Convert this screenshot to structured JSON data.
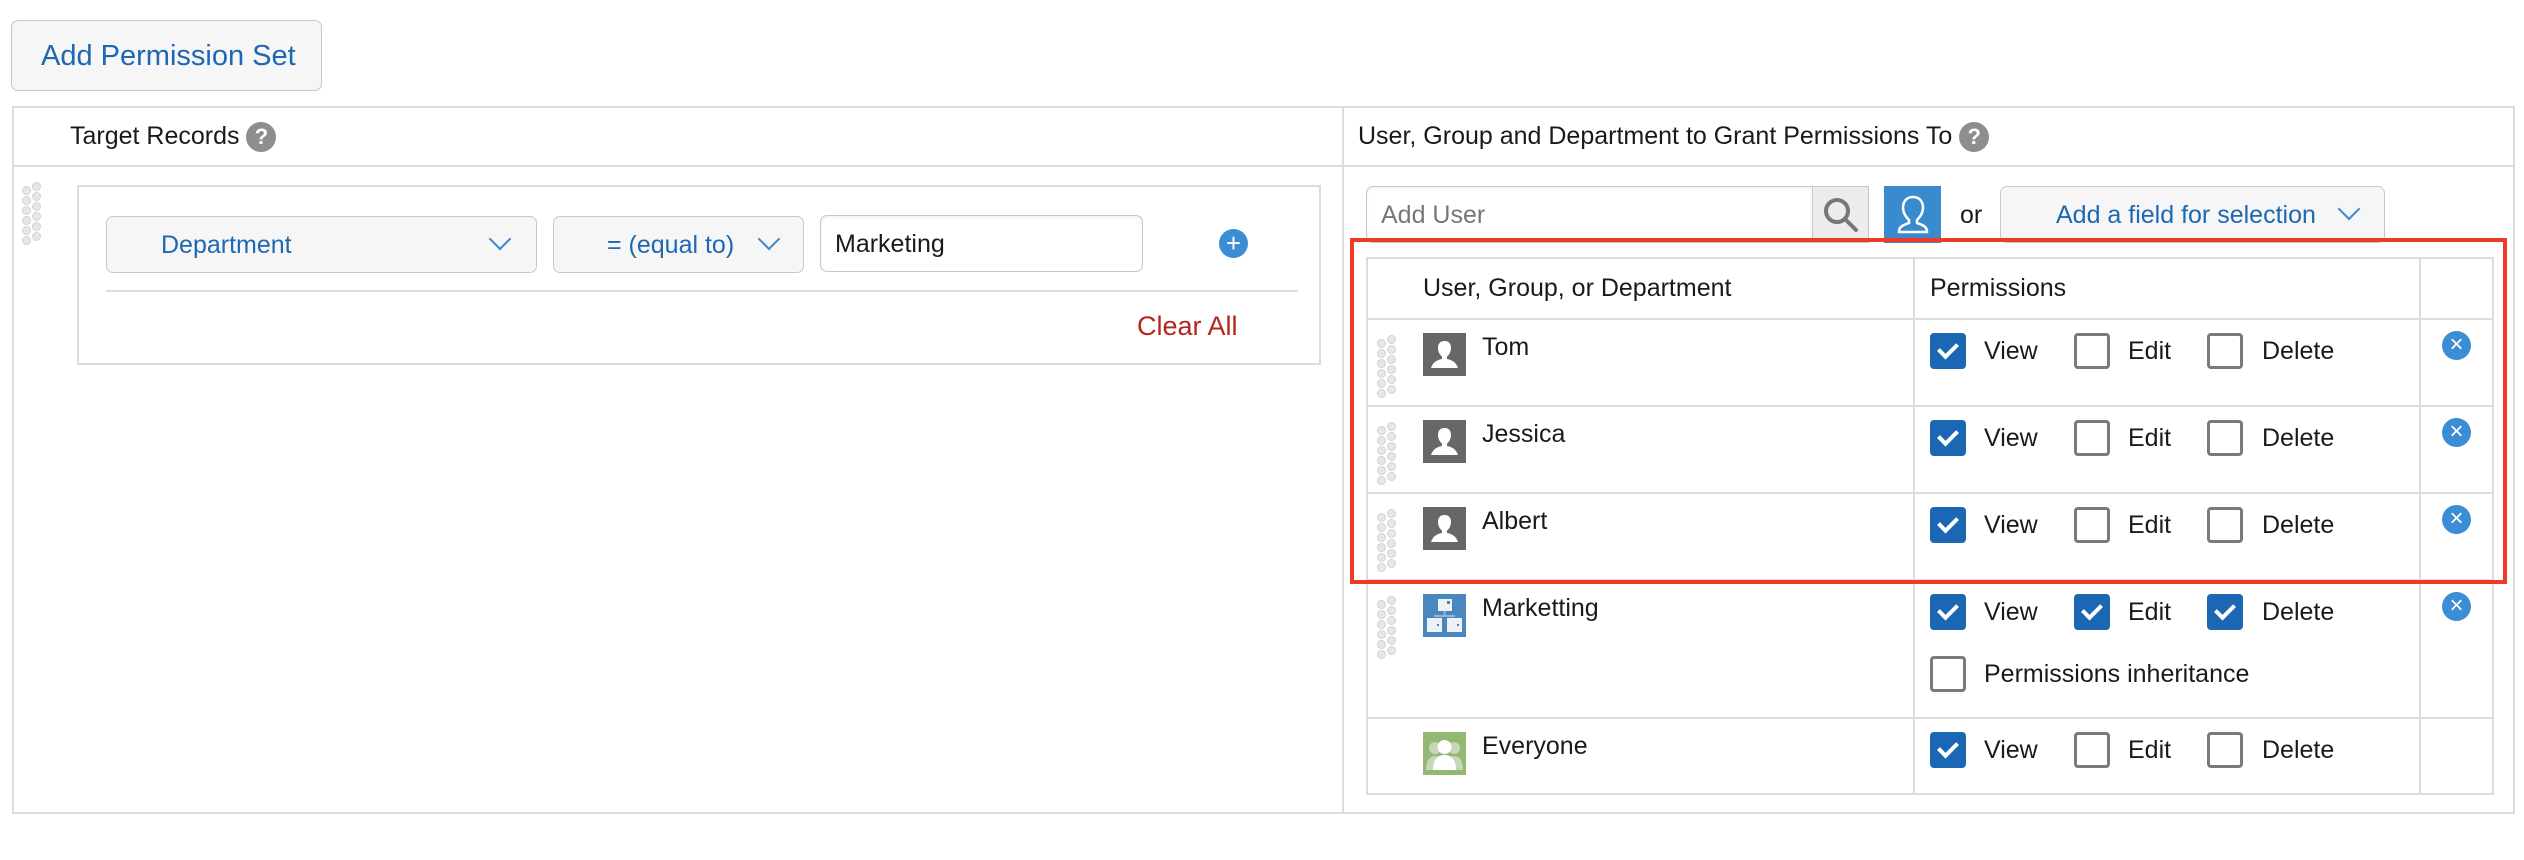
{
  "toolbar": {
    "add_permission_set": "Add Permission Set"
  },
  "left_panel": {
    "title": "Target Records",
    "help": "?",
    "filter": {
      "field": "Department",
      "operator": "= (equal to)",
      "value": "Marketing",
      "add_icon": "+",
      "clear_all": "Clear All"
    }
  },
  "right_panel": {
    "title": "User, Group and Department to Grant Permissions To",
    "help": "?",
    "add_user_placeholder": "Add User",
    "or_label": "or",
    "add_field_label": "Add a field for selection",
    "table": {
      "headers": [
        "User, Group, or Department",
        "Permissions"
      ],
      "rows": [
        {
          "name": "Tom",
          "type": "user",
          "view": true,
          "edit": false,
          "delete": false,
          "removable": true
        },
        {
          "name": "Jessica",
          "type": "user",
          "view": true,
          "edit": false,
          "delete": false,
          "removable": true
        },
        {
          "name": "Albert",
          "type": "user",
          "view": true,
          "edit": false,
          "delete": false,
          "removable": true
        },
        {
          "name": "Marketting",
          "type": "department",
          "view": true,
          "edit": true,
          "delete": true,
          "inheritance": false,
          "removable": true
        },
        {
          "name": "Everyone",
          "type": "group",
          "view": true,
          "edit": false,
          "delete": false,
          "removable": false
        }
      ],
      "perm_labels": {
        "view": "View",
        "edit": "Edit",
        "delete": "Delete",
        "inheritance": "Permissions inheritance"
      },
      "remove_icon": "×"
    }
  },
  "highlight": {
    "color": "#f03a28"
  }
}
